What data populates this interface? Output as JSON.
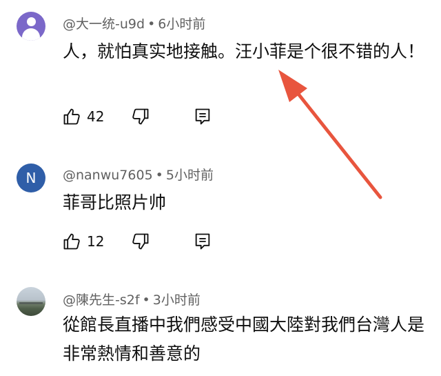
{
  "comments": [
    {
      "author": "@大一统-u9d",
      "separator": "•",
      "time": "6小时前",
      "text": "人，就怕真实地接触。汪小菲是个很不错的人！",
      "likes": "42"
    },
    {
      "author": "@nanwu7605",
      "avatar_letter": "N",
      "separator": "•",
      "time": "5小时前",
      "text": "菲哥比照片帅",
      "likes": "12"
    },
    {
      "author": "@陳先生-s2f",
      "separator": "•",
      "time": "3小时前",
      "text": "從館長直播中我們感受中國大陸對我們台灣人是非常熱情和善意的"
    }
  ],
  "icons": {
    "like": "thumbs-up-icon",
    "dislike": "thumbs-down-icon",
    "reply": "reply-icon"
  },
  "colors": {
    "annotation_arrow": "#e8553e",
    "avatar_purple": "#7b68c9",
    "avatar_blue": "#2f5ea8"
  }
}
